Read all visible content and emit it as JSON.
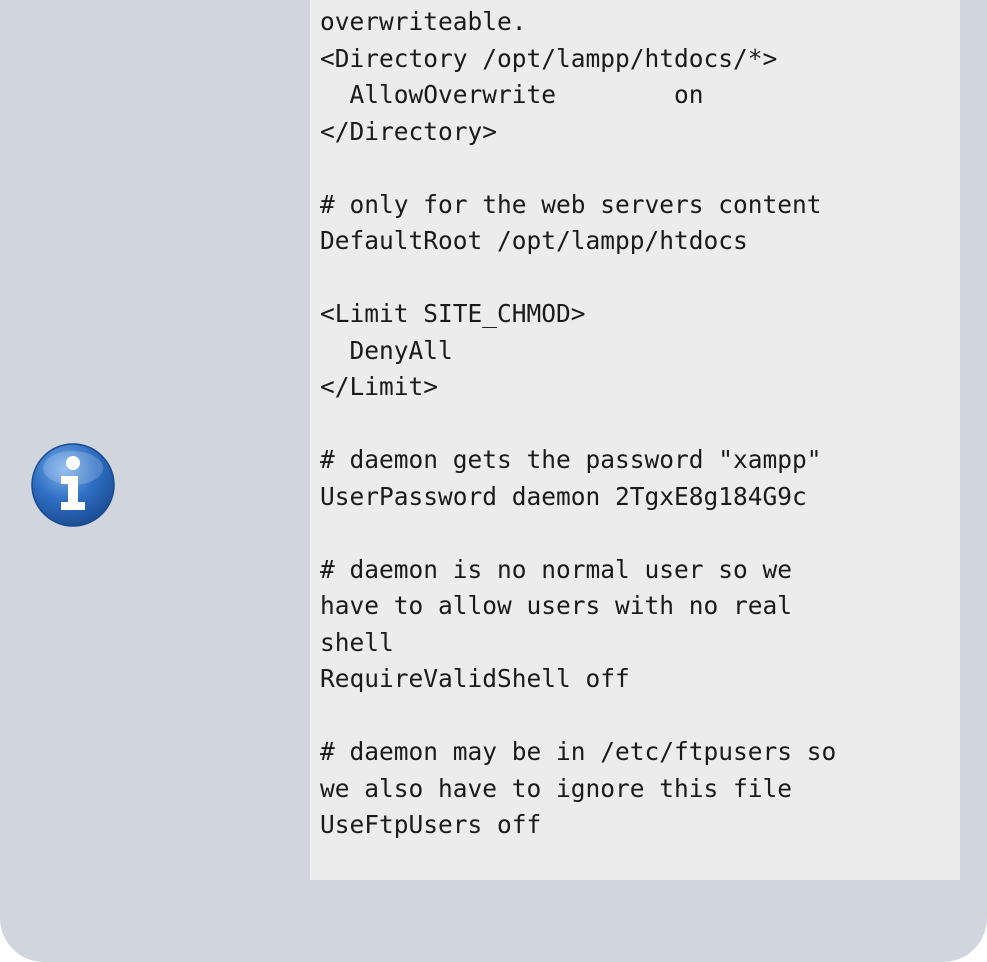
{
  "note": {
    "icon": "info-icon",
    "colors": {
      "background": "#d1d6de",
      "code_background": "#ececec",
      "icon_blue": "#2f6fc3"
    },
    "code": "overwriteable.\n<Directory /opt/lampp/htdocs/*>\n  AllowOverwrite        on\n</Directory>\n\n# only for the web servers content\nDefaultRoot /opt/lampp/htdocs\n\n<Limit SITE_CHMOD>\n  DenyAll\n</Limit>\n\n# daemon gets the password \"xampp\"\nUserPassword daemon 2TgxE8g184G9c\n\n# daemon is no normal user so we\nhave to allow users with no real\nshell\nRequireValidShell off\n\n# daemon may be in /etc/ftpusers so\nwe also have to ignore this file\nUseFtpUsers off"
  }
}
